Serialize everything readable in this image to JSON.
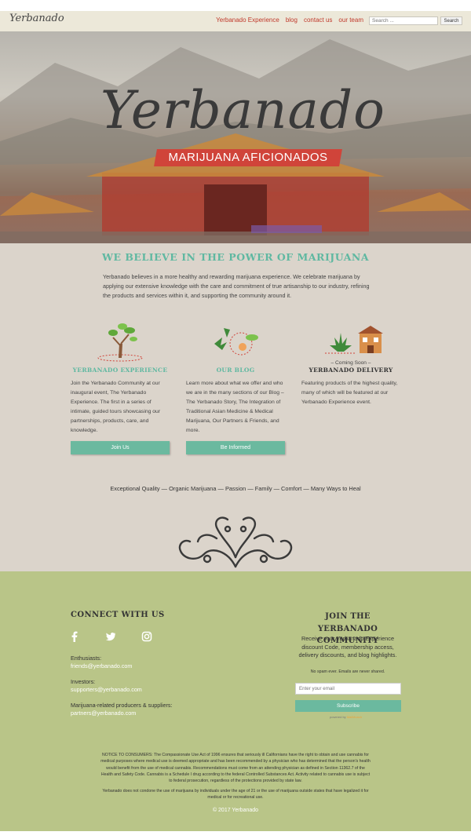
{
  "header": {
    "logo": "Yerbanado",
    "nav": [
      "Yerbanado Experience",
      "blog",
      "contact us",
      "our team"
    ],
    "search_placeholder": "Search ...",
    "search_button": "Search"
  },
  "hero": {
    "title": "Yerbanado",
    "subtitle": "MARIJUANA AFICIONADOS"
  },
  "main": {
    "heading": "WE BELIEVE IN THE POWER OF MARIJUANA",
    "intro": "Yerbanado believes in a more healthy and rewarding marijuana experience. We celebrate marijuana by applying our extensive knowledge with the care and commitment of true artisanship to our industry, refining the products and services within it, and supporting the community around it.",
    "columns": [
      {
        "title": "YERBANADO EXPERIENCE",
        "icon": "tree-icon",
        "text": "Join the Yerbanado Community at our inaugural event, The Yerbanado Experience. The first in a series of intimate, guided tours showcasing our partnerships, products, care, and knowledge.",
        "button": "Join Us"
      },
      {
        "title": "OUR BLOG",
        "icon": "leaves-cycle-icon",
        "text": "Learn more about what we offer and who we are in the many sections of our Blog – The Yerbanado Story, The Integration of Traditional Asian Medicine & Medical Marijuana, Our Partners & Friends, and more.",
        "button": "Be Informed"
      },
      {
        "coming": "– Coming Soon –",
        "title": "YERBANADO DELIVERY",
        "icon": "delivery-house-icon",
        "text": "Featuring products of the highest quality, many of which will be featured at our Yerbanado Experience event."
      }
    ],
    "tagline": "Exceptional Quality — Organic Marijuana — Passion — Family — Comfort — Many Ways to Heal"
  },
  "footer": {
    "connect_heading": "CONNECT WITH US",
    "social": [
      "facebook-icon",
      "twitter-icon",
      "instagram-icon"
    ],
    "contacts": [
      {
        "label": "Enthusiasts:",
        "email": "friends@yerbanado.com"
      },
      {
        "label": "Investors:",
        "email": "supporters@yerbanado.com"
      },
      {
        "label": "Marijuana-related producers & suppliers:",
        "email": "partners@yerbanado.com"
      }
    ],
    "join_heading": "JOIN THE YERBANADO COMMUNITY",
    "join_text": "Receive your Yerbanado Experience discount Code, membership access, delivery discounts, and blog highlights.",
    "spam_note": "No spam ever. Emails are never shared.",
    "email_placeholder": "Enter your email",
    "subscribe": "Subscribe",
    "powered_prefix": "powered by",
    "powered_brand": "MailMunch",
    "notice": "NOTICE TO CONSUMERS: The Compassionate Use Act of 1996 ensures that seriously ill Californians have the right to obtain and use cannabis for medical purposes where medical use is deemed appropriate and has been recommended by a physician who has determined that the person's health would benefit from the use of medical cannabis. Recommendations must come from an attending physician as defined in Section 11362.7 of the Health and Safety Code. Cannabis is a Schedule I drug according to the federal Controlled Substances Act. Activity related to cannabis use is subject to federal prosecution, regardless of the protections provided by state law.",
    "notice2": "Yerbanado does not condone the use of marijuana by individuals under the age of 21 or the use of marijuana outside states that have legalized it for medical or for recreational use.",
    "copyright": "© 2017 Yerbanado"
  },
  "colors": {
    "accent_teal": "#6bb99f",
    "nav_red": "#c0392b",
    "main_bg": "#dbd4cb",
    "footer_bg": "#b9c588"
  }
}
